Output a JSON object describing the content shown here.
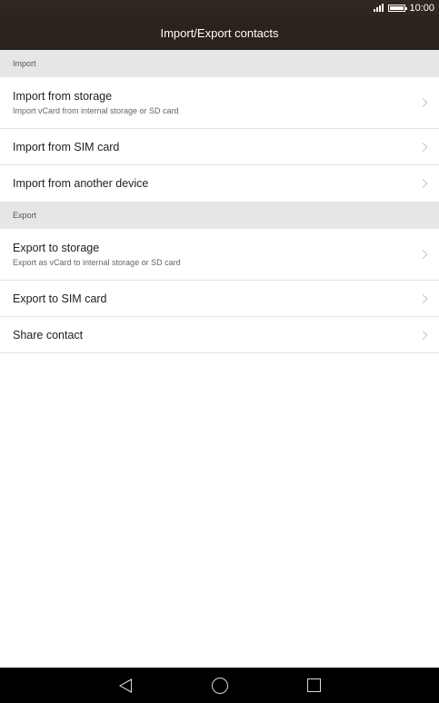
{
  "status_bar": {
    "time": "10:00",
    "icons": [
      "signal-icon",
      "battery-icon"
    ]
  },
  "header": {
    "title": "Import/Export contacts"
  },
  "sections": {
    "import": {
      "label": "Import",
      "items": [
        {
          "title": "Import from storage",
          "subtitle": "Import vCard from internal storage or SD card"
        },
        {
          "title": "Import from SIM card"
        },
        {
          "title": "Import from another device"
        }
      ]
    },
    "export": {
      "label": "Export",
      "items": [
        {
          "title": "Export to storage",
          "subtitle": "Export as vCard to internal storage or SD card"
        },
        {
          "title": "Export to SIM card"
        },
        {
          "title": "Share contact"
        }
      ]
    }
  },
  "nav_bar": {
    "icons": [
      "back-icon",
      "home-icon",
      "recent-apps-icon"
    ]
  }
}
